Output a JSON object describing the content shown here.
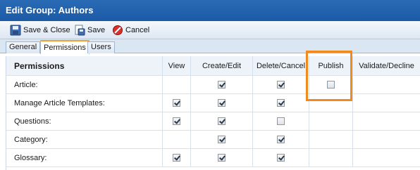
{
  "window": {
    "title": "Edit Group: Authors"
  },
  "toolbar": {
    "save_close_label": "Save & Close",
    "save_label": "Save",
    "cancel_label": "Cancel"
  },
  "tabs": [
    {
      "label": "General",
      "active": false
    },
    {
      "label": "Permissions",
      "active": true
    },
    {
      "label": "Users",
      "active": false
    }
  ],
  "table": {
    "columns": [
      "Permissions",
      "View",
      "Create/Edit",
      "Delete/Cancel",
      "Publish",
      "Validate/Decline"
    ],
    "rows": [
      {
        "label": "Article:",
        "checks": [
          null,
          true,
          true,
          false,
          null
        ]
      },
      {
        "label": "Manage Article Templates:",
        "checks": [
          true,
          true,
          true,
          null,
          null
        ]
      },
      {
        "label": "Questions:",
        "checks": [
          true,
          true,
          false,
          null,
          null
        ]
      },
      {
        "label": "Category:",
        "checks": [
          null,
          true,
          true,
          null,
          null
        ]
      },
      {
        "label": "Glossary:",
        "checks": [
          true,
          true,
          true,
          null,
          null
        ]
      }
    ]
  },
  "colors": {
    "titlebar": "#1b5aa6",
    "highlight": "#f08a1c",
    "tab_accent": "#f0a030"
  }
}
